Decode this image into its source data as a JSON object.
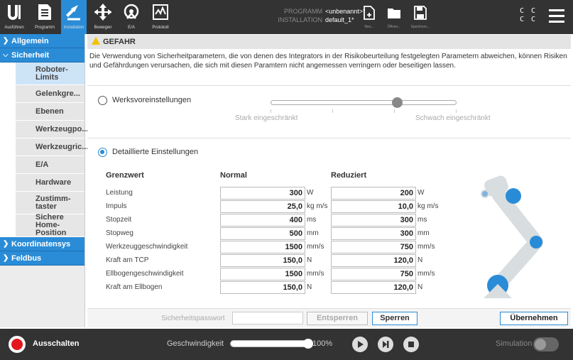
{
  "topbar": {
    "tabs": [
      {
        "label": "Ausführen",
        "icon": "ur-logo-icon"
      },
      {
        "label": "Programm",
        "icon": "program-icon"
      },
      {
        "label": "Installation",
        "icon": "installation-icon"
      }
    ],
    "tools": [
      {
        "label": "Bewegen",
        "icon": "move-icon"
      },
      {
        "label": "E/A",
        "icon": "io-icon"
      },
      {
        "label": "Protokoll",
        "icon": "log-icon"
      }
    ],
    "program_key": "PROGRAMM",
    "program_value": "<unbenannt>*",
    "installation_key": "INSTALLATION",
    "installation_value": "default_1*",
    "file_buttons": [
      {
        "label": "Neu...",
        "icon": "new-file-icon"
      },
      {
        "label": "Öffnen...",
        "icon": "open-folder-icon"
      },
      {
        "label": "Speichern...",
        "icon": "save-icon"
      }
    ],
    "cc_line1": "C C",
    "cc_line2": "C C"
  },
  "sidebar": {
    "sections": [
      {
        "label": "Allgemein",
        "expanded": false
      },
      {
        "label": "Sicherheit",
        "expanded": true
      },
      {
        "label": "Koordinatensys",
        "expanded": false
      },
      {
        "label": "Feldbus",
        "expanded": false
      }
    ],
    "items": [
      {
        "label": "Roboter-\nLimits",
        "selected": true
      },
      {
        "label": "Gelenkgre..."
      },
      {
        "label": "Ebenen"
      },
      {
        "label": "Werkzeugpo..."
      },
      {
        "label": "Werkzeugric..."
      },
      {
        "label": "E/A"
      },
      {
        "label": "Hardware"
      },
      {
        "label": "Zustimm-\ntaster"
      },
      {
        "label": "Sichere\nHome-Position"
      }
    ]
  },
  "warning": {
    "title": "GEFAHR",
    "text": "Die Verwendung von Sicherheitparametern, die von denen des Integrators in der Risikobeurteilung festgelegten Parametern abweichen, können Risiken und Gefährdungen verursachen, die sich mit diesen Paramtern nicht angemessen verringern oder beseitigen lassen."
  },
  "factory": {
    "label": "Werksvoreinstellungen",
    "selected": false,
    "slider_left": "Stark eingeschränkt",
    "slider_right": "Schwach eingeschränkt",
    "slider_level": 0.68
  },
  "detailed": {
    "label": "Detaillierte Einstellungen",
    "selected": true,
    "headers": {
      "limit": "Grenzwert",
      "normal": "Normal",
      "reduced": "Reduziert"
    },
    "rows": [
      {
        "label": "Leistung",
        "normal": "300",
        "normal_unit": "W",
        "reduced": "200",
        "reduced_unit": "W"
      },
      {
        "label": "Impuls",
        "normal": "25,0",
        "normal_unit": "kg m/s",
        "reduced": "10,0",
        "reduced_unit": "kg m/s"
      },
      {
        "label": "Stopzeit",
        "normal": "400",
        "normal_unit": "ms",
        "reduced": "300",
        "reduced_unit": "ms"
      },
      {
        "label": "Stopweg",
        "normal": "500",
        "normal_unit": "mm",
        "reduced": "300",
        "reduced_unit": "mm"
      },
      {
        "label": "Werkzeuggeschwindigkeit",
        "normal": "1500",
        "normal_unit": "mm/s",
        "reduced": "750",
        "reduced_unit": "mm/s"
      },
      {
        "label": "Kraft am TCP",
        "normal": "150,0",
        "normal_unit": "N",
        "reduced": "120,0",
        "reduced_unit": "N"
      },
      {
        "label": "Ellbogengeschwindigkeit",
        "normal": "1500",
        "normal_unit": "mm/s",
        "reduced": "750",
        "reduced_unit": "mm/s"
      },
      {
        "label": "Kraft am Ellbogen",
        "normal": "150,0",
        "normal_unit": "N",
        "reduced": "120,0",
        "reduced_unit": "N"
      }
    ]
  },
  "actions": {
    "password_label": "Sicherheitspasswort",
    "password_value": "",
    "unlock": "Entsperren",
    "lock": "Sperren",
    "apply": "Übernehmen"
  },
  "footer": {
    "power_label": "Ausschalten",
    "speed_label": "Geschwindigkeit",
    "speed_value": "100%",
    "speed_level": 1.0,
    "simulation_label": "Simulation",
    "simulation_on": false
  },
  "colors": {
    "accent": "#2a8cd7",
    "warning": "#f2c200",
    "power": "#e3161c",
    "bar": "#333333"
  }
}
